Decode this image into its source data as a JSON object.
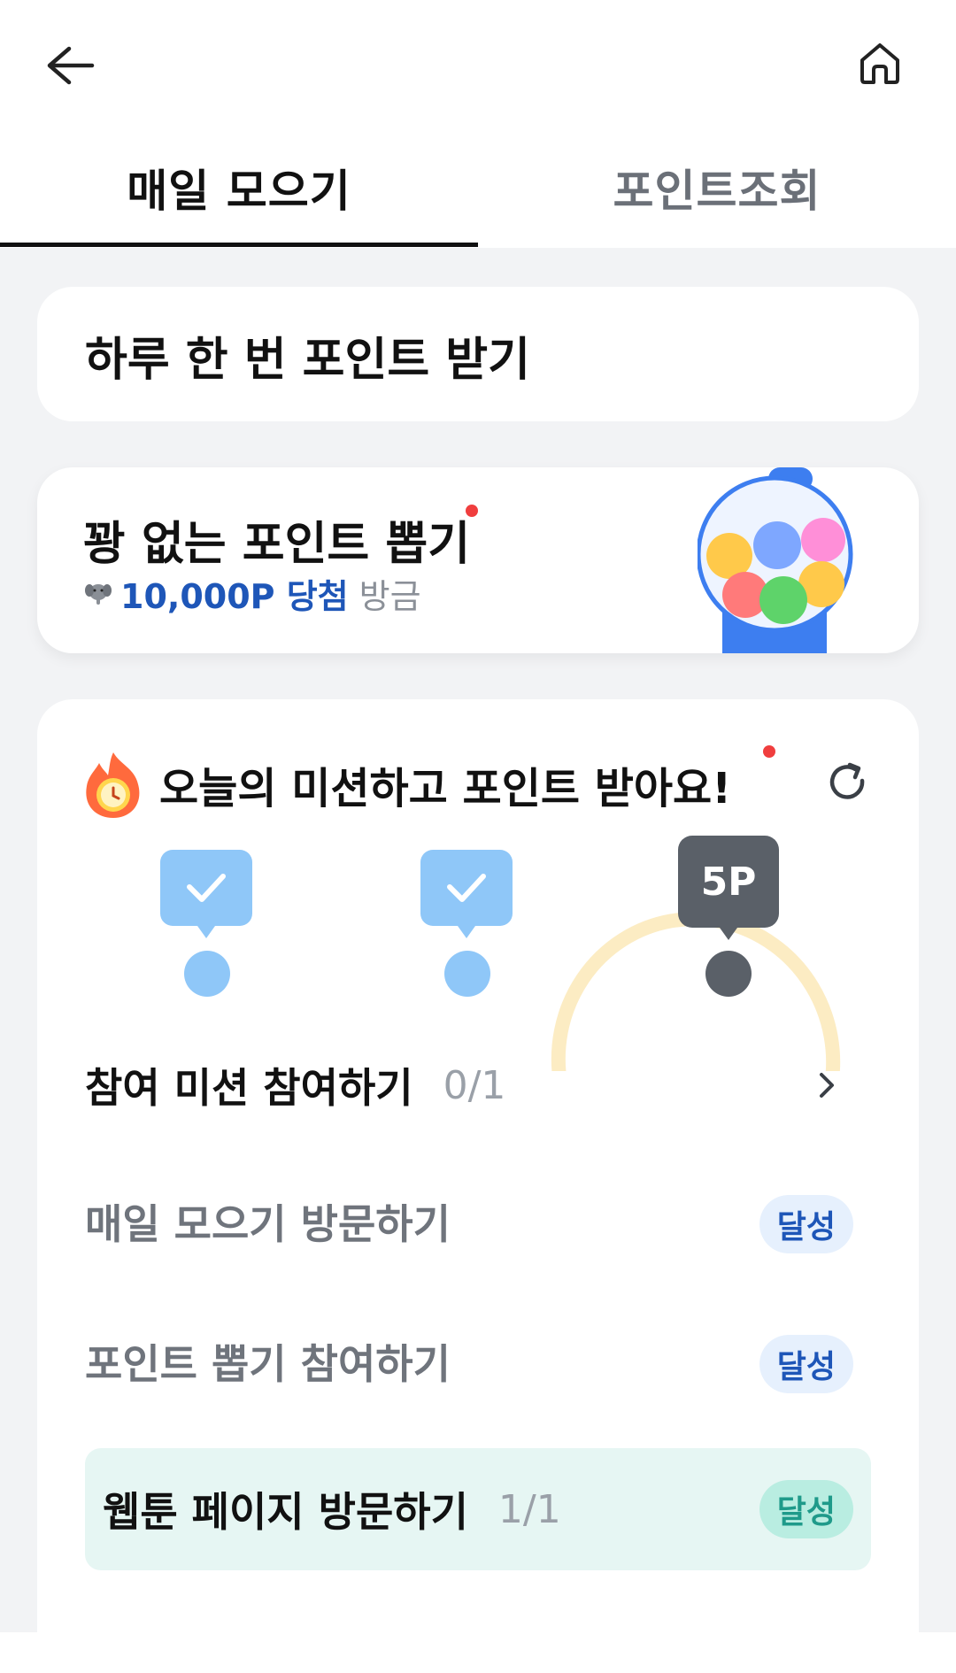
{
  "header": {
    "back_icon": "arrow-left-icon",
    "home_icon": "home-icon"
  },
  "tabs": [
    {
      "label": "매일 모으기",
      "active": true
    },
    {
      "label": "포인트조회",
      "active": false
    }
  ],
  "daily_card": {
    "title": "하루 한 번 포인트 받기"
  },
  "draw_card": {
    "title": "꽝 없는 포인트 뽑기",
    "mascot_icon": "elephant-icon",
    "prize": "10,000P 당첨",
    "suffix": "방금"
  },
  "mission": {
    "title": "오늘의 미션하고 포인트 받아요!",
    "fire_icon": "fire-clock-icon",
    "refresh_icon": "refresh-icon",
    "progress": {
      "steps_total": 3,
      "steps_completed": 2,
      "reward_label": "5P"
    },
    "items": [
      {
        "label": "참여 미션 참여하기",
        "count": "0/1",
        "badge": ""
      },
      {
        "label": "매일 모으기 방문하기",
        "count": "",
        "badge": "달성"
      },
      {
        "label": "포인트 뽑기 참여하기",
        "count": "",
        "badge": "달성"
      },
      {
        "label": "웹툰 페이지 방문하기",
        "count": "1/1",
        "badge": "달성"
      }
    ]
  },
  "colors": {
    "accent_blue": "#1e56b8",
    "step_done": "#8fc7f8",
    "step_pending": "#5a6068",
    "highlight_row": "#e6f6f3",
    "teal_badge_text": "#1f9a8a",
    "annotation_circle": "#fbe9b8"
  }
}
